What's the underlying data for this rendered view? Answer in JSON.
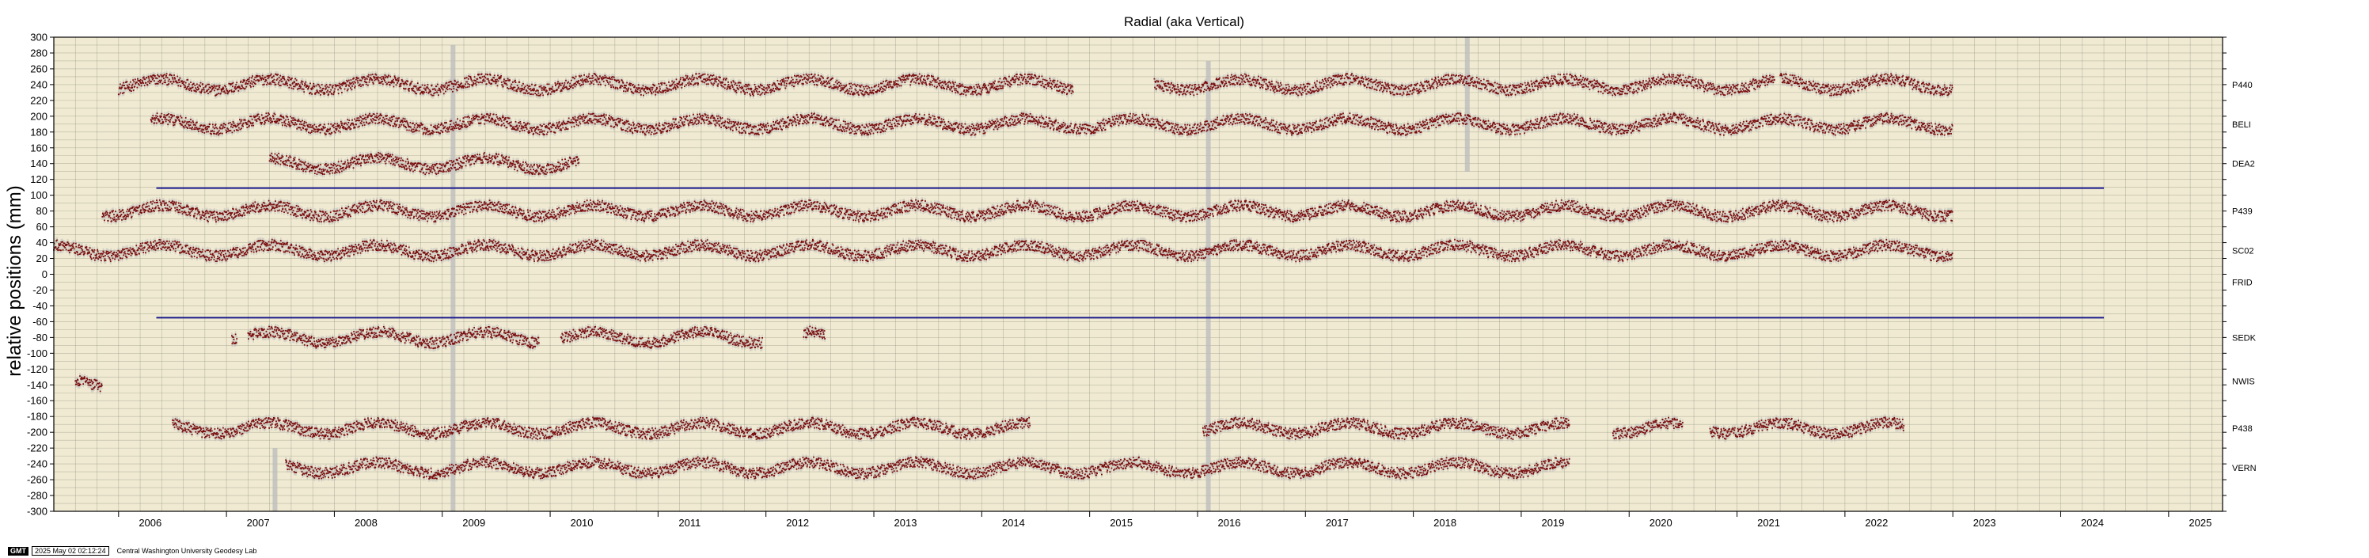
{
  "footer": {
    "badge": "GMT",
    "timestamp": "2025 May 02 02:12:24",
    "credit": "Central Washington University Geodesy Lab"
  },
  "chart_data": {
    "type": "scatter",
    "title": "Radial (aka Vertical)",
    "ylabel": "relative positions (mm)",
    "xlabel": "",
    "xlim": [
      2005.4,
      2025.5
    ],
    "ylim": [
      -300,
      300
    ],
    "y_major_ticks": [
      300,
      280,
      260,
      240,
      220,
      200,
      180,
      160,
      140,
      120,
      100,
      80,
      60,
      40,
      20,
      0,
      -20,
      -40,
      -60,
      -80,
      -100,
      -120,
      -140,
      -160,
      -180,
      -200,
      -220,
      -240,
      -260,
      -280,
      -300
    ],
    "x_ticks": [
      2006,
      2007,
      2008,
      2009,
      2010,
      2011,
      2012,
      2013,
      2014,
      2015,
      2016,
      2017,
      2018,
      2019,
      2020,
      2021,
      2022,
      2023,
      2024,
      2025
    ],
    "grid": true,
    "background": "#f0ead2",
    "point_color": "#7a0d0d",
    "error_color": "#bdbdbd",
    "reference_line_color": "#1a1a8c",
    "stations": [
      {
        "name": "P440",
        "offset": 240,
        "segments": [
          [
            2006.0,
            2006.25
          ],
          [
            2006.25,
            2014.85
          ],
          [
            2015.6,
            2021.35
          ],
          [
            2021.4,
            2023.0
          ]
        ]
      },
      {
        "name": "BELI",
        "offset": 190,
        "segments": [
          [
            2006.3,
            2023.0
          ]
        ]
      },
      {
        "name": "DEA2",
        "offset": 140,
        "segments": [
          [
            2007.4,
            2009.95
          ],
          [
            2009.95,
            2010.27
          ]
        ]
      },
      {
        "name": "P439",
        "offset": 80,
        "segments": [
          [
            2005.85,
            2023.0
          ]
        ]
      },
      {
        "name": "SC02",
        "offset": 30,
        "segments": [
          [
            2005.4,
            2023.0
          ]
        ]
      },
      {
        "name": "FRID",
        "offset": -10,
        "segments": []
      },
      {
        "name": "SEDK",
        "offset": -80,
        "segments": [
          [
            2007.05,
            2007.1
          ],
          [
            2007.2,
            2009.9
          ],
          [
            2010.1,
            2011.97
          ],
          [
            2012.35,
            2012.55
          ]
        ]
      },
      {
        "name": "NWIS",
        "offset": -135,
        "segments": [
          [
            2005.6,
            2005.85
          ]
        ]
      },
      {
        "name": "P438",
        "offset": -195,
        "segments": [
          [
            2006.5,
            2014.45
          ],
          [
            2016.05,
            2019.45
          ],
          [
            2019.85,
            2020.5
          ],
          [
            2020.75,
            2022.55
          ]
        ]
      },
      {
        "name": "VERN",
        "offset": -245,
        "segments": [
          [
            2007.55,
            2019.45
          ]
        ]
      }
    ],
    "reference_lines": [
      {
        "y": 109,
        "x_start": 2006.35,
        "x_end": 2024.4
      },
      {
        "y": -55,
        "x_start": 2006.35,
        "x_end": 2024.4
      }
    ],
    "disturbances": [
      {
        "x": 2007.45,
        "y_from": -300,
        "y_to": -220
      },
      {
        "x": 2009.1,
        "y_from": -300,
        "y_to": 290
      },
      {
        "x": 2016.1,
        "y_from": -300,
        "y_to": 270
      },
      {
        "x": 2018.5,
        "y_from": 130,
        "y_to": 300
      }
    ]
  }
}
